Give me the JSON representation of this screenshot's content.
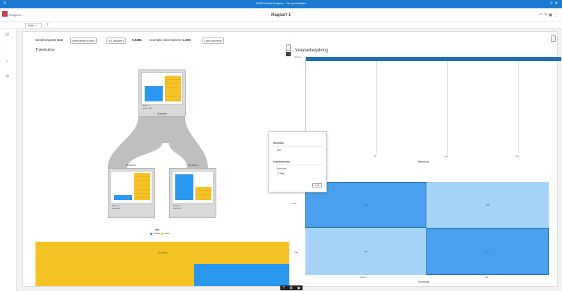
{
  "app": {
    "title": "SAS® Visual Analytics - Vis og visualiser"
  },
  "toolbar": {
    "edit_label": "Rediger­er...",
    "report_title": "Rapport 1"
  },
  "tabs": [
    {
      "label": "Side 1"
    }
  ],
  "summary": {
    "response_label": "Beslutningstræ",
    "response_value": "Sex",
    "button_event": "(hændelse=mulie)",
    "button_ks": "KS (Nuulen)",
    "stat_value": "0,5386",
    "obs_label": "Anvendte observationer",
    "obs_value": "1.309",
    "pipeline_button": "Opret pipeline"
  },
  "tree": {
    "title": "Træstruktur",
    "root_label": "Survived",
    "root_note1": "Node n: 1",
    "root_note2": "antal: 1.309",
    "left_label": "Perished",
    "right_label": "Survived",
    "left_note1": "Node n: 2",
    "left_note2": "antal: 808",
    "right_note1": "Node n: 3",
    "right_note2": "antal: 501",
    "legend_title": "Sex",
    "legend_female": "female",
    "legend_male": "male"
  },
  "icicle": {
    "label": "Survived"
  },
  "importance": {
    "title": "Variabelbetydning",
    "bar_label": "Survived",
    "x_ticks": [
      "50",
      "100",
      "150"
    ],
    "x_label": "Betydning",
    "chart_data": {
      "type": "bar",
      "categories": [
        "Survived"
      ],
      "values": [
        180
      ],
      "xlabel": "Betydning",
      "xlim": [
        0,
        180
      ]
    }
  },
  "popup": {
    "section1": "RESPONS",
    "response_value": "Sex",
    "section2": "FORUDSIGTERE",
    "predictor_value": "Survived",
    "add_label": "Tilføj",
    "close_label": "Luk"
  },
  "confusion": {
    "rows": [
      "female",
      "male"
    ],
    "cols": [
      "female",
      "male"
    ],
    "cells": [
      [
        "310",
        "126"
      ],
      [
        "161",
        "677"
      ]
    ],
    "x_label": "Forudsagt",
    "colors": {
      "dark": "#4aa0ec",
      "light": "#a6d3f8"
    }
  },
  "bottom_toolbar": [
    "?",
    "⊞",
    "◆"
  ]
}
